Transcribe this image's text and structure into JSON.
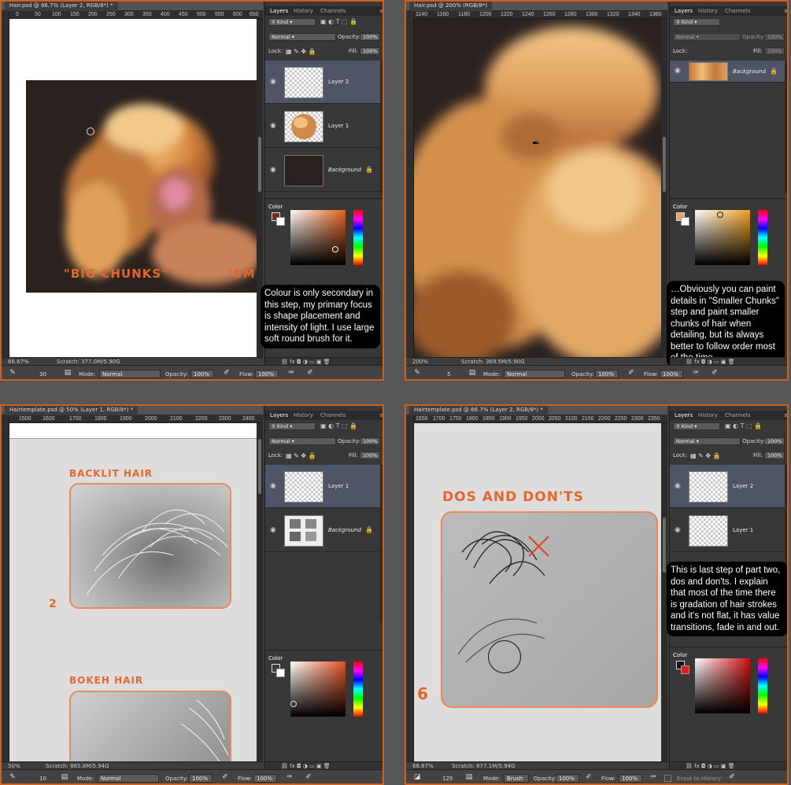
{
  "panels": {
    "tabs": [
      "Layers",
      "History",
      "Channels"
    ],
    "kind": "Kind",
    "blend_mode": "Normal",
    "opacity_label": "Opacity:",
    "lock_label": "Lock:",
    "fill_label": "Fill:",
    "percent_100": "100%",
    "color_title": "Color",
    "mode_label": "Mode:",
    "flow_label": "Flow:"
  },
  "q1": {
    "doc_title": "Hair.psd @ 66.7% (Layer 2, RGB/8*) *",
    "ruler_ticks": [
      "0",
      "50",
      "100",
      "150",
      "200",
      "250",
      "300",
      "350",
      "400",
      "450",
      "500",
      "550",
      "600",
      "650"
    ],
    "zoom": "66.67%",
    "scratch": "Scratch: 377.0M/5.90G",
    "layers": [
      "Layer 2",
      "Layer 1",
      "Background"
    ],
    "brush_size": "30",
    "mode": "Normal",
    "opacity": "100%",
    "flow": "100%",
    "canvas_text_1": "\"BIG CHUNKS\"",
    "canvas_text_2": "\"SM",
    "caption": "Colour is only secondary in this step, my primary focus is shape placement and intensity of light. I use large soft round brush for it.",
    "fg_color": "#6b2e17"
  },
  "q2": {
    "doc_title": "Hair.psd @ 200% (RGB/8*)",
    "ruler_ticks": [
      "1140",
      "1160",
      "1180",
      "1200",
      "1220",
      "1240",
      "1260",
      "1280",
      "1300",
      "1320",
      "1340",
      "1360"
    ],
    "zoom": "200%",
    "scratch": "Scratch: 369.5M/5.90G",
    "layers": [
      "Background"
    ],
    "brush_size": "5",
    "mode": "Normal",
    "opacity": "100%",
    "flow": "100%",
    "caption": "…Obviously you can paint details in \"Smaller Chunks\" step and paint smaller chunks of hair when detailing, but its always better to follow order most of the time.",
    "fg_color": "#e8a466"
  },
  "q3": {
    "doc_title": "Hairtemplate.psd @ 50% (Layer 1, RGB/8*) *",
    "ruler_ticks": [
      "1500",
      "1600",
      "1700",
      "1800",
      "1900",
      "2000",
      "2100",
      "2200",
      "2300",
      "2400"
    ],
    "zoom": "50%",
    "scratch": "Scratch: 865.8M/5.94G",
    "layers": [
      "Layer 1",
      "Background"
    ],
    "brush_size": "10",
    "mode": "Normal",
    "opacity": "100%",
    "flow": "100%",
    "heading_1": "BACKLIT HAIR",
    "heading_2": "BOKEH HAIR",
    "number": "2",
    "fg_color": "#3a3a3a"
  },
  "q4": {
    "doc_title": "Hairtemplate.psd @ 66.7% (Layer 2, RGB/8*) *",
    "ruler_ticks": [
      "1650",
      "1700",
      "1750",
      "1800",
      "1850",
      "1900",
      "1950",
      "2000",
      "2050",
      "2100",
      "2150",
      "2200",
      "2250",
      "2300",
      "2350"
    ],
    "zoom": "66.67%",
    "scratch": "Scratch: 877.1M/5.94G",
    "layers": [
      "Layer 2",
      "Layer 1"
    ],
    "brush_size": "125",
    "mode": "Brush",
    "opacity": "100%",
    "flow": "100%",
    "erase_label": "Erase to History",
    "heading": "DOS AND DON'TS",
    "number": "6",
    "caption": "This is last step of part two, dos and don'ts. I explain that most of the time there is gradation of hair strokes and it's not flat, it has value transitions, fade in and out.",
    "fg_color": "#111111",
    "bg_color": "#e02020"
  }
}
